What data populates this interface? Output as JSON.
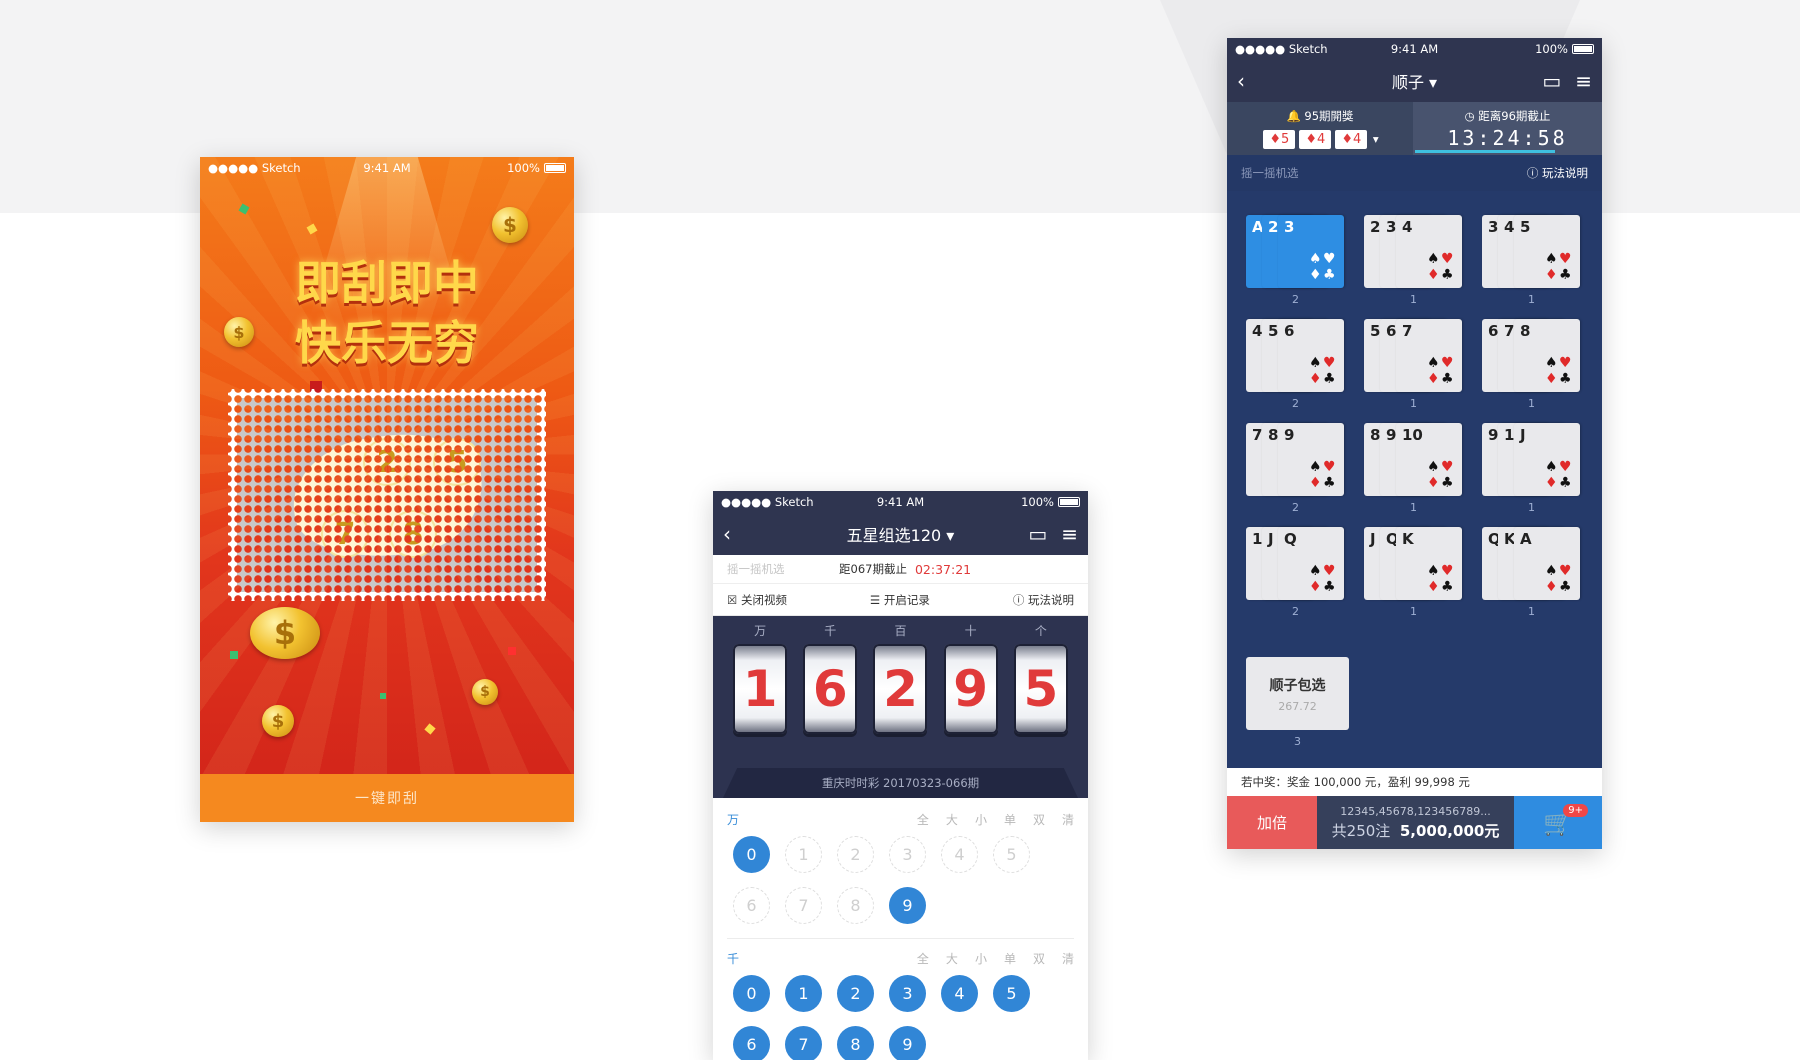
{
  "status": {
    "carrier": "●●●●● Sketch",
    "time": "9:41 AM",
    "battery": "100%"
  },
  "scratch": {
    "slogan_line1": "即刮即中",
    "slogan_line2": "快乐无穷",
    "balls": [
      "2",
      "5",
      "7",
      "8"
    ],
    "button": "一键即刮",
    "coin_symbol": "$"
  },
  "lottery": {
    "nav_title": "五星组选120 ▾",
    "shake": "摇一摇机选",
    "deadline_label": "距067期截止",
    "deadline_time": "02:37:21",
    "close_video": "关闭视频",
    "history": "开启记录",
    "rules": "玩法说明",
    "positions": [
      "万",
      "千",
      "百",
      "十",
      "个"
    ],
    "reels": [
      "1",
      "6",
      "2",
      "9",
      "5"
    ],
    "draw_info": "重庆时时彩 20170323-066期",
    "filters": [
      "全",
      "大",
      "小",
      "单",
      "双",
      "清"
    ],
    "row1": {
      "label": "万",
      "balls": [
        {
          "n": "0",
          "on": true
        },
        {
          "n": "1",
          "on": false
        },
        {
          "n": "2",
          "on": false
        },
        {
          "n": "3",
          "on": false
        },
        {
          "n": "4",
          "on": false
        },
        {
          "n": "5",
          "on": false
        },
        {
          "n": "6",
          "on": false
        },
        {
          "n": "7",
          "on": false
        },
        {
          "n": "8",
          "on": false
        },
        {
          "n": "9",
          "on": true
        }
      ]
    },
    "row2": {
      "label": "千",
      "balls": [
        {
          "n": "0",
          "on": true
        },
        {
          "n": "1",
          "on": true
        },
        {
          "n": "2",
          "on": true
        },
        {
          "n": "3",
          "on": true
        },
        {
          "n": "4",
          "on": true
        },
        {
          "n": "5",
          "on": true
        },
        {
          "n": "6",
          "on": true
        },
        {
          "n": "7",
          "on": true
        },
        {
          "n": "8",
          "on": true
        },
        {
          "n": "9",
          "on": true
        }
      ]
    }
  },
  "poker": {
    "nav_title": "顺子 ▾",
    "last_draw": "95期開獎",
    "last_cards": [
      "♦5",
      "♦4",
      "♦4"
    ],
    "countdown_label": "距离96期截止",
    "countdown": "13:24:58",
    "shake": "摇一摇机选",
    "rules": "玩法说明",
    "sets": [
      {
        "ranks": [
          "A",
          "2",
          "3"
        ],
        "count": "2",
        "selected": true
      },
      {
        "ranks": [
          "2",
          "3",
          "4"
        ],
        "count": "1",
        "selected": false
      },
      {
        "ranks": [
          "3",
          "4",
          "5"
        ],
        "count": "1",
        "selected": false
      },
      {
        "ranks": [
          "4",
          "5",
          "6"
        ],
        "count": "2",
        "selected": false
      },
      {
        "ranks": [
          "5",
          "6",
          "7"
        ],
        "count": "1",
        "selected": false
      },
      {
        "ranks": [
          "6",
          "7",
          "8"
        ],
        "count": "1",
        "selected": false
      },
      {
        "ranks": [
          "7",
          "8",
          "9"
        ],
        "count": "2",
        "selected": false
      },
      {
        "ranks": [
          "8",
          "9",
          "10"
        ],
        "count": "1",
        "selected": false
      },
      {
        "ranks": [
          "9",
          "10",
          "J"
        ],
        "count": "1",
        "selected": false
      },
      {
        "ranks": [
          "10",
          "J",
          "Q"
        ],
        "count": "2",
        "selected": false
      },
      {
        "ranks": [
          "J",
          "Q",
          "K"
        ],
        "count": "1",
        "selected": false
      },
      {
        "ranks": [
          "Q",
          "K",
          "A"
        ],
        "count": "1",
        "selected": false
      }
    ],
    "package_title": "顺子包选",
    "package_value": "267.72",
    "package_count": "3",
    "prize_text": "若中奖：奖金 100,000 元，盈利 99,998 元",
    "double_btn": "加倍",
    "bet_numbers": "12345,45678,123456789...",
    "bet_count": "共250注",
    "bet_amount": "5,000,000元",
    "cart_badge": "9+"
  }
}
